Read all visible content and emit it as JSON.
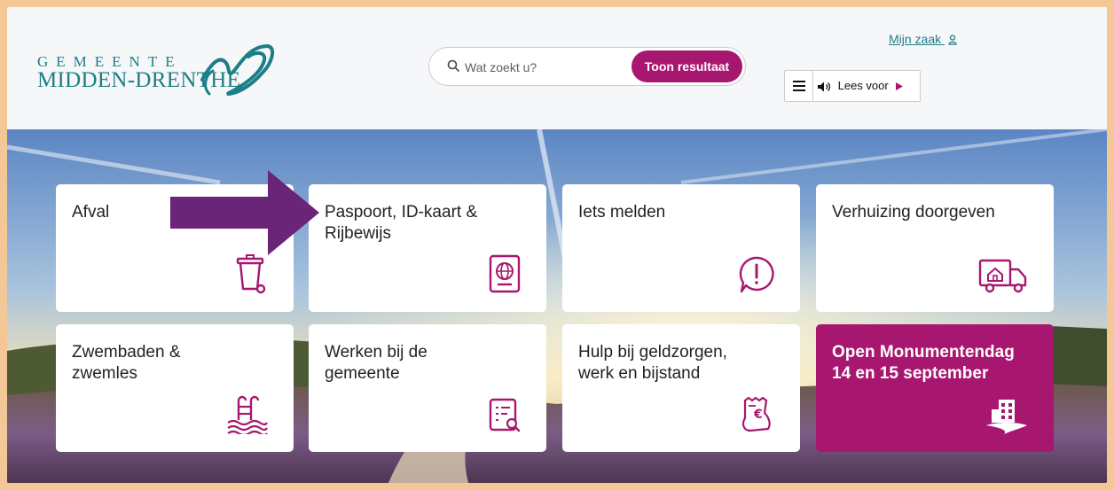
{
  "logo": {
    "line1": "GEMEENTE",
    "line2": "MIDDEN-DRENTHE"
  },
  "search": {
    "placeholder": "Wat zoekt u?",
    "button_label": "Toon resultaat"
  },
  "account": {
    "label": "Mijn zaak"
  },
  "readspeaker": {
    "label": "Lees voor"
  },
  "tiles": [
    {
      "label": "Afval",
      "icon": "trash-bin-icon"
    },
    {
      "label": "Paspoort, ID-kaart &\nRijbewijs",
      "icon": "passport-icon"
    },
    {
      "label": "Iets melden",
      "icon": "alert-bubble-icon"
    },
    {
      "label": "Verhuizing doorgeven",
      "icon": "moving-truck-icon"
    },
    {
      "label": "Zwembaden &\nzwemles",
      "icon": "swimming-pool-icon"
    },
    {
      "label": "Werken bij de\ngemeente",
      "icon": "job-document-icon"
    },
    {
      "label": "Hulp bij geldzorgen,\nwerk en bijstand",
      "icon": "money-receipt-icon"
    },
    {
      "label": "Open Monumentendag\n14 en 15 september",
      "icon": "monument-building-icon"
    }
  ],
  "colors": {
    "accent": "#a8176f",
    "brand": "#1b7f86",
    "arrow": "#6a2478",
    "outer_frame": "#f4c896"
  }
}
